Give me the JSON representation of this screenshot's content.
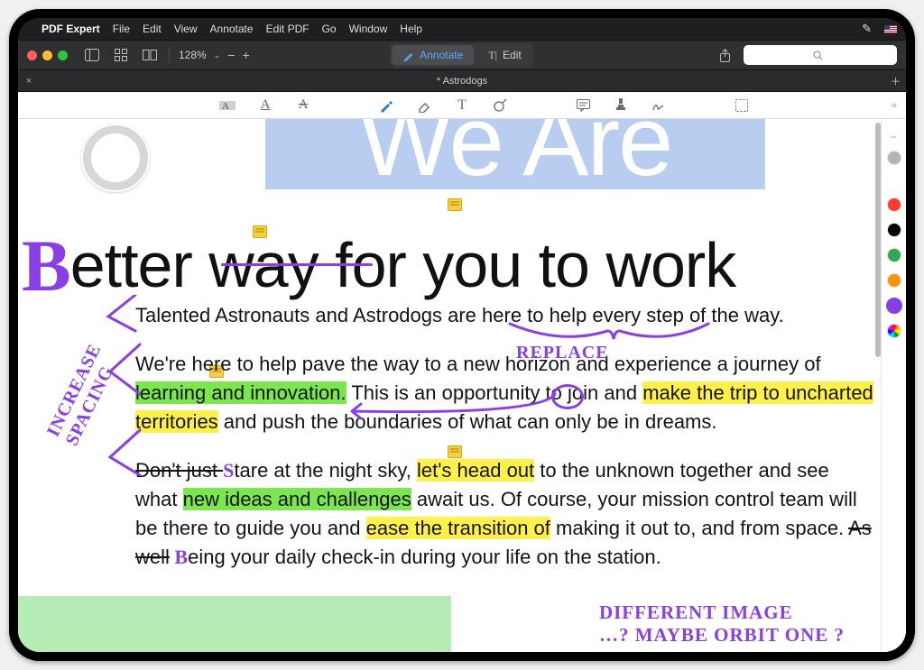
{
  "menubar": {
    "app": "PDF Expert",
    "items": [
      "File",
      "Edit",
      "View",
      "Annotate",
      "Edit PDF",
      "Go",
      "Window",
      "Help"
    ]
  },
  "toolbar": {
    "zoom_pct": "128%",
    "modes": {
      "annotate": "Annotate",
      "edit": "Edit"
    }
  },
  "tab": {
    "title": "* Astrodogs"
  },
  "search": {
    "placeholder": ""
  },
  "document": {
    "banner": "We Are",
    "headline_prefix_letter": "B",
    "headline": "etter way for you to work",
    "p1": "Talented Astronauts and Astrodogs are here to help every step of the way.",
    "p2_a": "We're here to help pave the way to a new horizon and experience a journey of ",
    "p2_hl_g": "learning and innovation.",
    "p2_b": " This is an opportunity to join and ",
    "p2_hl_y1": "make the trip to uncharted territories",
    "p2_c": " and push the boundaries of what can only be in dreams.",
    "p3_strike": "Don't just ",
    "p3_s_ins": "S",
    "p3_a": "tare at the night sky, ",
    "p3_hl_y": "let's head out",
    "p3_b": " to the unknown together and see what ",
    "p3_hl_g": "new ideas and challenges",
    "p3_c": " await us. Of course, your mission control team will be there to guide you and ",
    "p3_hl_y2": "ease the transition of",
    "p3_d": " making it out to, and from space. ",
    "p3_strike2": "As well",
    "p3_b_ins": " B",
    "p3_e": "eing your daily check-in during your life on the station."
  },
  "handwriting": {
    "increase_spacing": "INCREASE SPACING",
    "replace": "REPLACE",
    "different_image_l1": "DIFFERENT  IMAGE",
    "different_image_l2": "…?  MAYBE  ORBIT  ONE ?"
  },
  "side_panel": {
    "colors": [
      "#b3b3b3",
      "#ff3b30",
      "#000000",
      "#2fa84f",
      "#ff9500",
      "#8a3fe6"
    ]
  }
}
